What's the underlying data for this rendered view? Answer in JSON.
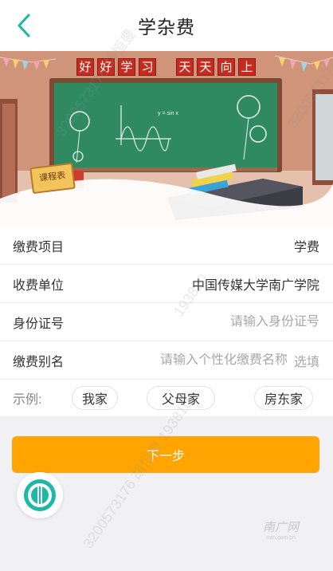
{
  "header": {
    "title": "学杂费",
    "back_icon": "chevron-left-icon"
  },
  "banner": {
    "slogan_left": [
      "好",
      "好",
      "学",
      "习"
    ],
    "slogan_right": [
      "天",
      "天",
      "向",
      "上"
    ],
    "board_formula": "y = sin x",
    "schedule_label": "课程表"
  },
  "form": {
    "item_label": "缴费项目",
    "item_value": "学费",
    "payee_label": "收费单位",
    "payee_value": "中国传媒大学南广学院",
    "id_label": "身份证号",
    "id_placeholder": "请输入身份证号",
    "alias_label": "缴费别名",
    "alias_placeholder": "请输入个性化缴费名称",
    "alias_suffix": "选填",
    "examples_label": "示例:",
    "examples": [
      "我家",
      "父母家",
      "房东家"
    ]
  },
  "actions": {
    "next_label": "下一步"
  },
  "watermarks": [
    "3200573176 胡恒豊",
    "193810",
    "3200573176 胡恒豊 193810",
    "3200573176 胡恒豊"
  ],
  "corner_logo": {
    "main": "南广网",
    "sub": "nan.com.cn"
  },
  "colors": {
    "accent": "#1cb9a8",
    "button": "#ffa400",
    "chalkboard": "#2f8a61"
  }
}
